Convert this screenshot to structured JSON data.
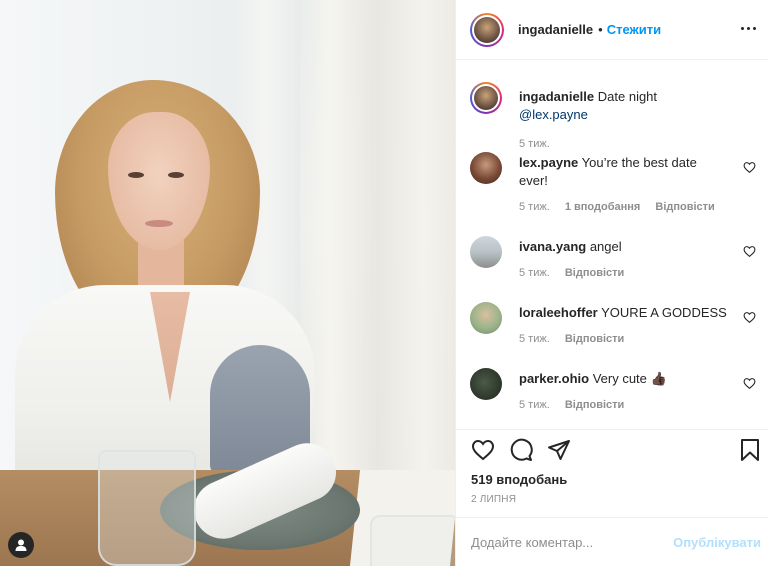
{
  "post": {
    "author": "ingadanielle",
    "separator": "•",
    "follow_label": "Стежити",
    "more_icon": "more-horizontal-icon",
    "caption": {
      "username": "ingadanielle",
      "text": "Date night",
      "mention": "@lex.payne",
      "age": "5 тиж."
    },
    "likes": "519 вподобань",
    "date": "2 ЛИПНЯ"
  },
  "comments": [
    {
      "username": "lex.payne",
      "text": "You’re the best date ever!",
      "age": "5 тиж.",
      "likes": "1 вподобання",
      "reply": "Відповісти"
    },
    {
      "username": "ivana.yang",
      "text": "angel",
      "age": "5 тиж.",
      "reply": "Відповісти"
    },
    {
      "username": "loraleehoffer",
      "text": "YOURE A GODDESS",
      "age": "5 тиж.",
      "reply": "Відповісти"
    },
    {
      "username": "parker.ohio",
      "text": "Very cute 👍🏿",
      "age": "5 тиж.",
      "reply": "Відповісти"
    }
  ],
  "add_comment": {
    "placeholder": "Додайте коментар...",
    "publish_label": "Опублікувати"
  },
  "colors": {
    "link_blue": "#0095f6",
    "publish_disabled": "#b2dffc",
    "muted_text": "#8e8e8e"
  }
}
